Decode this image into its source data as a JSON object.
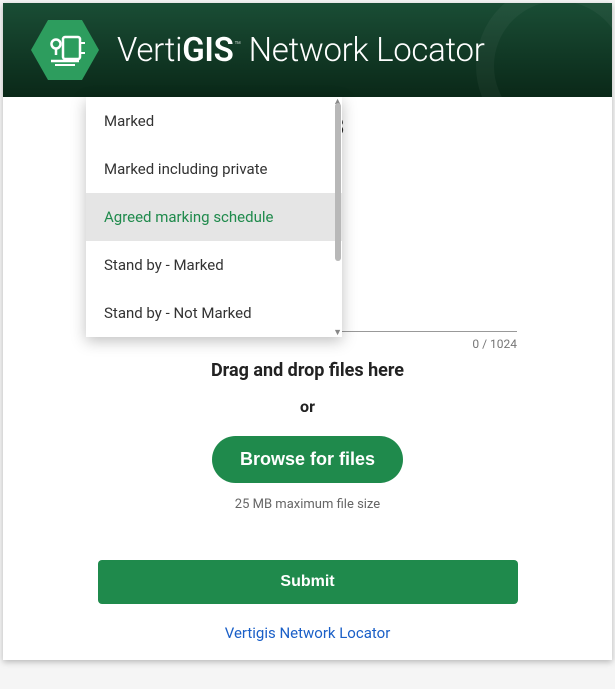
{
  "header": {
    "brand_prefix": "Verti",
    "brand_bold": "GIS",
    "brand_suffix": " Network Locator"
  },
  "form": {
    "ticket_fragment": "003",
    "char_counter": "0 / 1024"
  },
  "dropdown": {
    "items": [
      {
        "label": "Marked",
        "selected": false
      },
      {
        "label": "Marked including private",
        "selected": false
      },
      {
        "label": "Agreed marking schedule",
        "selected": true
      },
      {
        "label": "Stand by - Marked",
        "selected": false
      },
      {
        "label": "Stand by - Not Marked",
        "selected": false
      }
    ]
  },
  "dropzone": {
    "title": "Drag and drop files here",
    "or": "or",
    "browse_label": "Browse for files",
    "max_size": "25 MB maximum file size"
  },
  "actions": {
    "submit_label": "Submit"
  },
  "footer": {
    "link_text": "Vertigis Network Locator"
  }
}
